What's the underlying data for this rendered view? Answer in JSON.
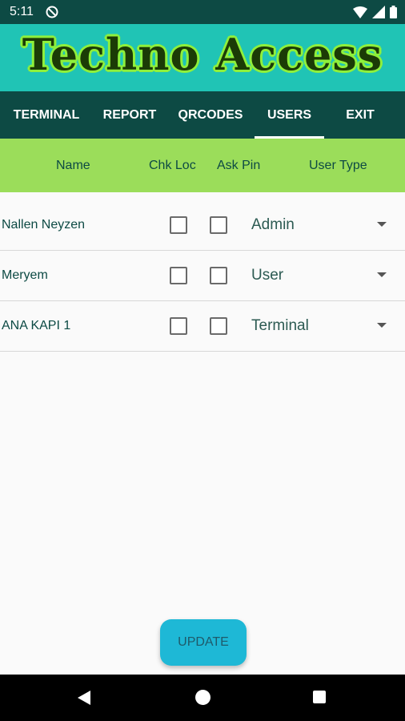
{
  "status": {
    "time": "5:11"
  },
  "app": {
    "title": "Techno Access"
  },
  "tabs": [
    "TERMINAL",
    "REPORT",
    "QRCODES",
    "USERS",
    "EXIT"
  ],
  "columns": {
    "name": "Name",
    "chk_loc": "Chk Loc",
    "ask_pin": "Ask Pin",
    "user_type": "User Type"
  },
  "users": [
    {
      "name": "Nallen Neyzen",
      "chk_loc": false,
      "ask_pin": false,
      "type": "Admin"
    },
    {
      "name": "Meryem",
      "chk_loc": false,
      "ask_pin": false,
      "type": "User"
    },
    {
      "name": "ANA KAPI 1",
      "chk_loc": false,
      "ask_pin": false,
      "type": "Terminal"
    }
  ],
  "actions": {
    "update": "UPDATE"
  },
  "colors": {
    "toolbar": "#0d4a44",
    "banner": "#20c4b5",
    "header": "#9bdd5a",
    "button": "#1eb8d6"
  }
}
